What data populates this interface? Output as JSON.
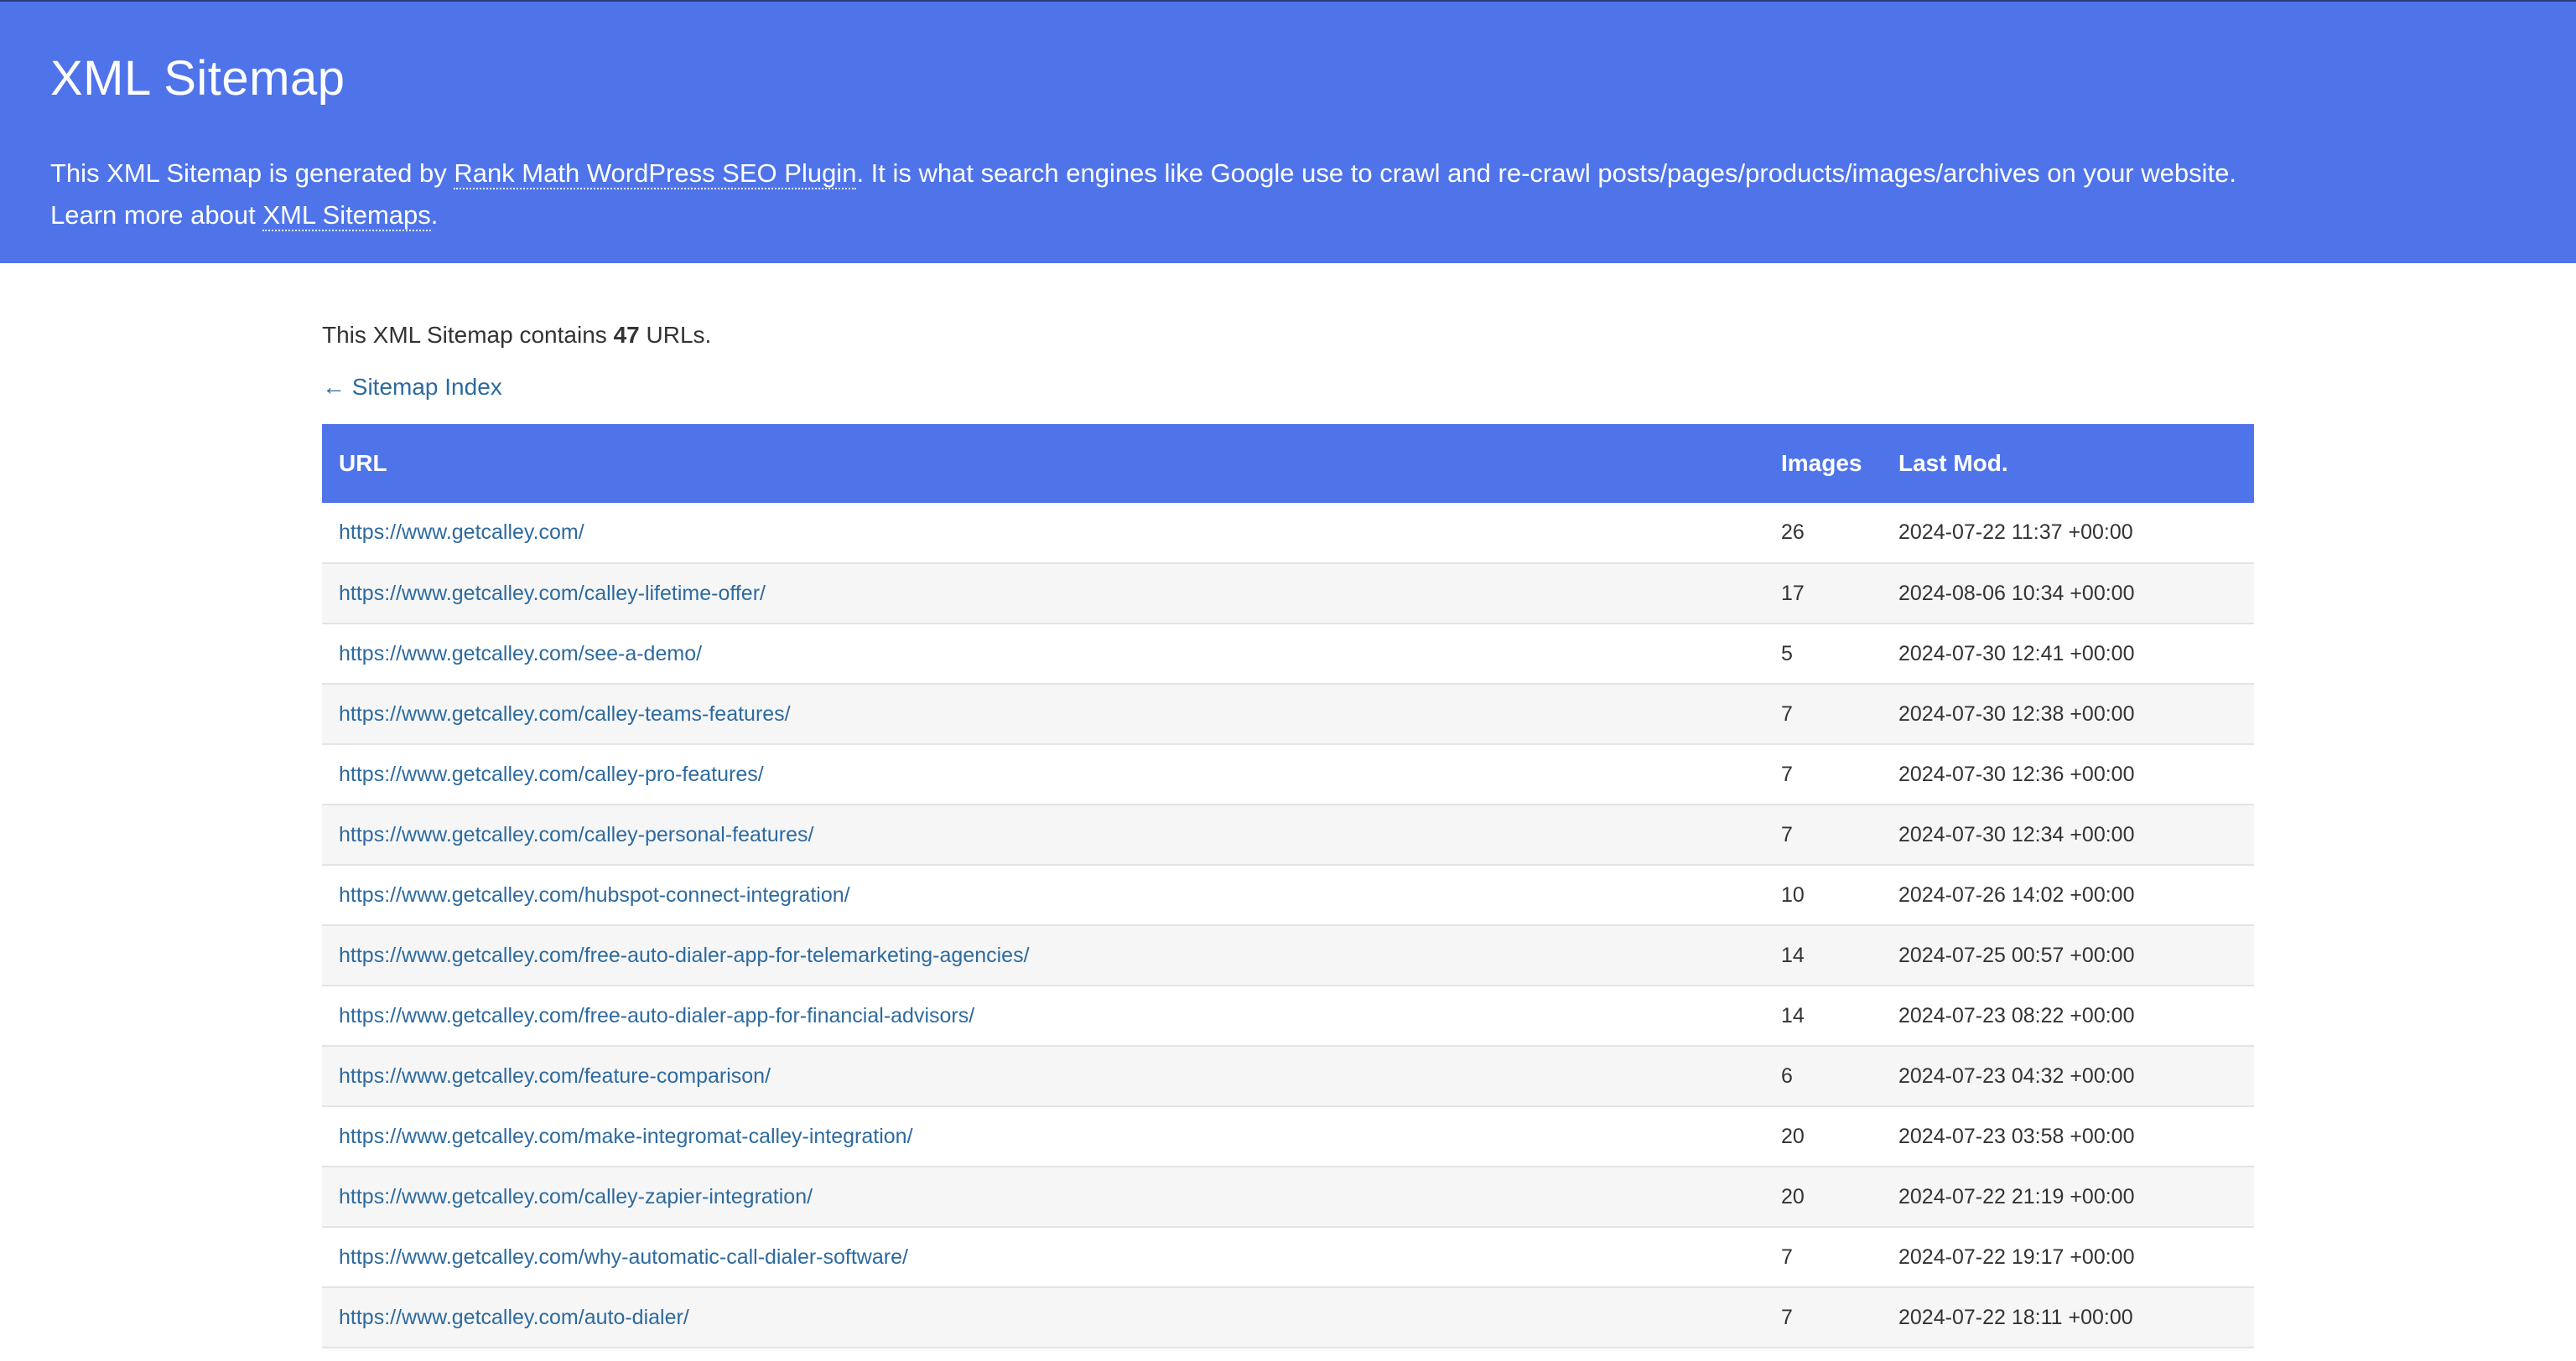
{
  "header": {
    "title": "XML Sitemap",
    "desc_prefix": "This XML Sitemap is generated by ",
    "plugin_link": "Rank Math WordPress SEO Plugin",
    "desc_middle": ". It is what search engines like Google use to crawl and re-crawl posts/pages/products/images/archives on your website.",
    "learn_prefix": "Learn more about ",
    "learn_link": "XML Sitemaps",
    "learn_suffix": "."
  },
  "summary": {
    "prefix": "This XML Sitemap contains ",
    "count": "47",
    "suffix": " URLs."
  },
  "index_link": "← Sitemap Index",
  "table": {
    "headers": {
      "url": "URL",
      "images": "Images",
      "last_mod": "Last Mod."
    },
    "rows": [
      {
        "url": "https://www.getcalley.com/",
        "images": "26",
        "last_mod": "2024-07-22 11:37 +00:00"
      },
      {
        "url": "https://www.getcalley.com/calley-lifetime-offer/",
        "images": "17",
        "last_mod": "2024-08-06 10:34 +00:00"
      },
      {
        "url": "https://www.getcalley.com/see-a-demo/",
        "images": "5",
        "last_mod": "2024-07-30 12:41 +00:00"
      },
      {
        "url": "https://www.getcalley.com/calley-teams-features/",
        "images": "7",
        "last_mod": "2024-07-30 12:38 +00:00"
      },
      {
        "url": "https://www.getcalley.com/calley-pro-features/",
        "images": "7",
        "last_mod": "2024-07-30 12:36 +00:00"
      },
      {
        "url": "https://www.getcalley.com/calley-personal-features/",
        "images": "7",
        "last_mod": "2024-07-30 12:34 +00:00"
      },
      {
        "url": "https://www.getcalley.com/hubspot-connect-integration/",
        "images": "10",
        "last_mod": "2024-07-26 14:02 +00:00"
      },
      {
        "url": "https://www.getcalley.com/free-auto-dialer-app-for-telemarketing-agencies/",
        "images": "14",
        "last_mod": "2024-07-25 00:57 +00:00"
      },
      {
        "url": "https://www.getcalley.com/free-auto-dialer-app-for-financial-advisors/",
        "images": "14",
        "last_mod": "2024-07-23 08:22 +00:00"
      },
      {
        "url": "https://www.getcalley.com/feature-comparison/",
        "images": "6",
        "last_mod": "2024-07-23 04:32 +00:00"
      },
      {
        "url": "https://www.getcalley.com/make-integromat-calley-integration/",
        "images": "20",
        "last_mod": "2024-07-23 03:58 +00:00"
      },
      {
        "url": "https://www.getcalley.com/calley-zapier-integration/",
        "images": "20",
        "last_mod": "2024-07-22 21:19 +00:00"
      },
      {
        "url": "https://www.getcalley.com/why-automatic-call-dialer-software/",
        "images": "7",
        "last_mod": "2024-07-22 19:17 +00:00"
      },
      {
        "url": "https://www.getcalley.com/auto-dialer/",
        "images": "7",
        "last_mod": "2024-07-22 18:11 +00:00"
      }
    ]
  },
  "colors": {
    "header_bg": "#4f74ea",
    "link": "#2d6a9f",
    "row_alt": "#f6f6f6"
  }
}
